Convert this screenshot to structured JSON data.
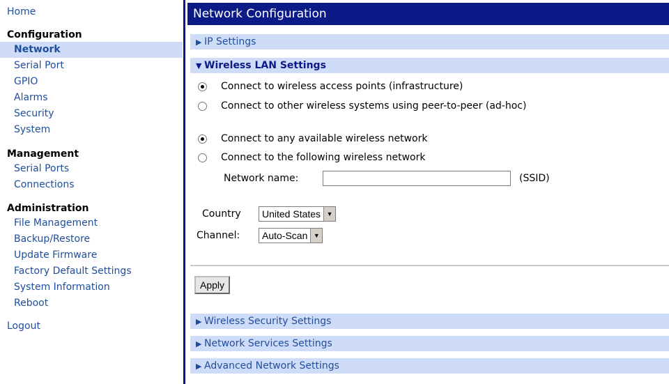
{
  "sidebar": {
    "home": "Home",
    "configuration": {
      "title": "Configuration",
      "items": [
        "Network",
        "Serial Port",
        "GPIO",
        "Alarms",
        "Security",
        "System"
      ]
    },
    "management": {
      "title": "Management",
      "items": [
        "Serial Ports",
        "Connections"
      ]
    },
    "administration": {
      "title": "Administration",
      "items": [
        "File Management",
        "Backup/Restore",
        "Update Firmware",
        "Factory Default Settings",
        "System Information",
        "Reboot"
      ]
    },
    "logout": "Logout"
  },
  "main": {
    "title": "Network Configuration",
    "sections": {
      "ip": "IP Settings",
      "wlan": "Wireless LAN Settings",
      "security": "Wireless Security Settings",
      "services": "Network Services Settings",
      "advanced": "Advanced Network Settings"
    },
    "mode_options": [
      "Connect to wireless access points (infrastructure)",
      "Connect to other wireless systems using peer-to-peer (ad-hoc)"
    ],
    "network_options": [
      "Connect to any available wireless network",
      "Connect to the following wireless network"
    ],
    "network_name_label": "Network name:",
    "network_name_value": "",
    "ssid_label": "(SSID)",
    "country_label": "Country",
    "country_value": "United States",
    "channel_label": "Channel:",
    "channel_value": "Auto-Scan",
    "apply_label": "Apply"
  }
}
